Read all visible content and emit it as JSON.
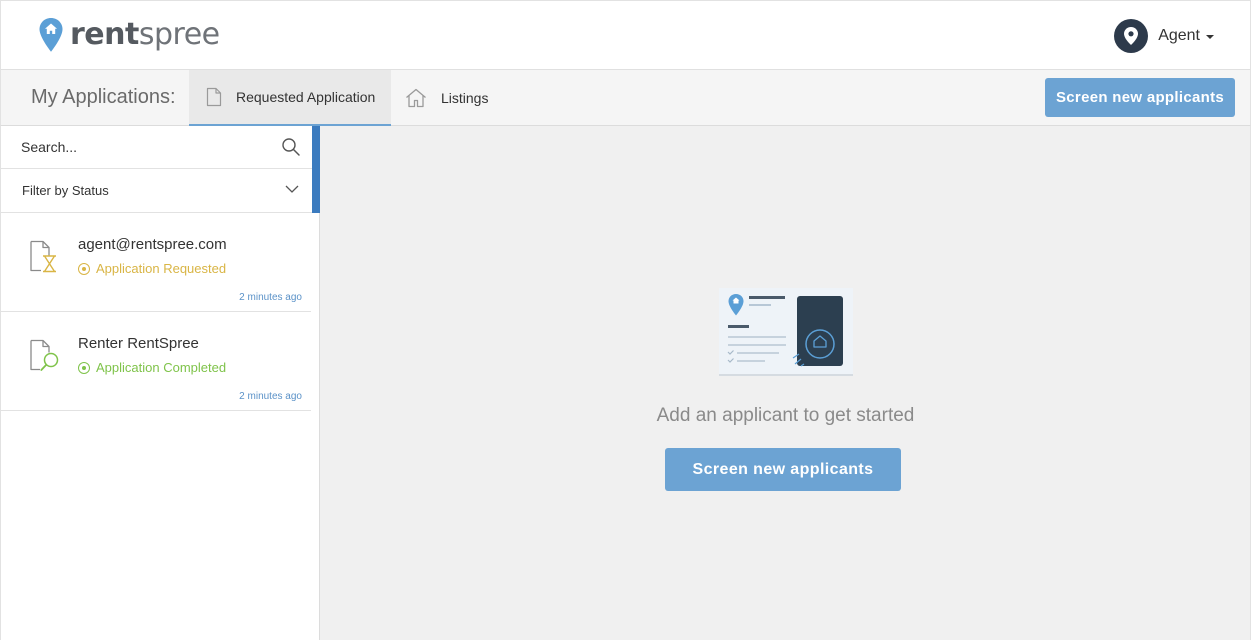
{
  "header": {
    "logo": {
      "rent": "rent",
      "spree": "spree"
    },
    "user": {
      "name": "Agent"
    }
  },
  "nav": {
    "title": "My Applications:",
    "tabs": [
      {
        "label": "Requested Application",
        "icon": "document-icon",
        "active": true
      },
      {
        "label": "Listings",
        "icon": "house-icon",
        "active": false
      }
    ],
    "cta_label": "Screen new applicants"
  },
  "sidebar": {
    "search": {
      "placeholder": "Search..."
    },
    "filter": {
      "label": "Filter by Status"
    },
    "applications": [
      {
        "name": "agent@rentspree.com",
        "status": "Application Requested",
        "status_color": "#d9b545",
        "icon": "hourglass-document-icon",
        "time": "2 minutes ago"
      },
      {
        "name": "Renter RentSpree",
        "status": "Application Completed",
        "status_color": "#7fc34a",
        "icon": "search-document-icon",
        "time": "2 minutes ago"
      }
    ]
  },
  "main": {
    "empty_message": "Add an applicant to get started",
    "cta_label": "Screen new applicants"
  },
  "colors": {
    "accent": "#6ca3d3",
    "accent_dark": "#3b7bbf",
    "navy": "#2d3a4b"
  }
}
